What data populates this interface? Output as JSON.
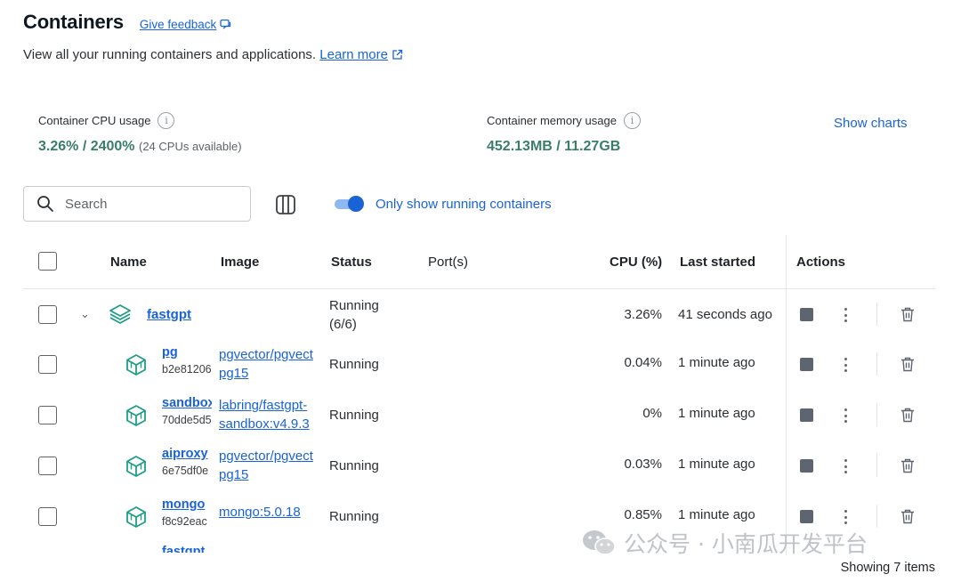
{
  "header": {
    "title": "Containers",
    "feedback": "Give feedback",
    "subtitle": "View all your running containers and applications.",
    "learn_more": "Learn more"
  },
  "stats": {
    "cpu_label": "Container CPU usage",
    "cpu_value": "3.26% / 2400%",
    "cpu_note": "(24 CPUs available)",
    "memory_label": "Container memory usage",
    "memory_value": "452.13MB / 11.27GB",
    "show_charts": "Show charts"
  },
  "toolbar": {
    "search_placeholder": "Search",
    "only_running_label": "Only show running containers",
    "only_running_enabled": true
  },
  "table": {
    "columns": [
      "Name",
      "Image",
      "Status",
      "Port(s)",
      "CPU (%)",
      "Last started",
      "Actions"
    ],
    "group": {
      "name": "fastgpt",
      "status_line1": "Running",
      "status_line2": "(6/6)",
      "cpu": "3.26%",
      "last_started": "41 seconds ago"
    },
    "rows": [
      {
        "name": "pg",
        "id": "b2e81206",
        "image_line1": "pgvector/pgvect",
        "image_line2": "pg15",
        "status": "Running",
        "cpu": "0.04%",
        "last_started": "1 minute ago"
      },
      {
        "name": "sandbox",
        "id": "70dde5d5",
        "image_line1": "labring/fastgpt-",
        "image_line2": "sandbox:v4.9.3",
        "status": "Running",
        "cpu": "0%",
        "last_started": "1 minute ago"
      },
      {
        "name": "aiproxy",
        "id": "6e75df0e",
        "image_line1": "pgvector/pgvect",
        "image_line2": "pg15",
        "status": "Running",
        "cpu": "0.03%",
        "last_started": "1 minute ago"
      },
      {
        "name": "mongo",
        "id": "f8c92eac",
        "image_line1": "mongo:5.0.18",
        "image_line2": "",
        "status": "Running",
        "cpu": "0.85%",
        "last_started": "1 minute ago"
      },
      {
        "name": "fastgpt",
        "id": "",
        "image_line1": "",
        "image_line2": "",
        "status": "",
        "cpu": "",
        "last_started": ""
      }
    ]
  },
  "footer": {
    "showing": "Showing 7 items"
  },
  "watermark": "公众号 · 小南瓜开发平台",
  "colors": {
    "accent": "#1a63d6",
    "stat_green": "#3a7d6a",
    "container_icon": "#1e9e86"
  }
}
